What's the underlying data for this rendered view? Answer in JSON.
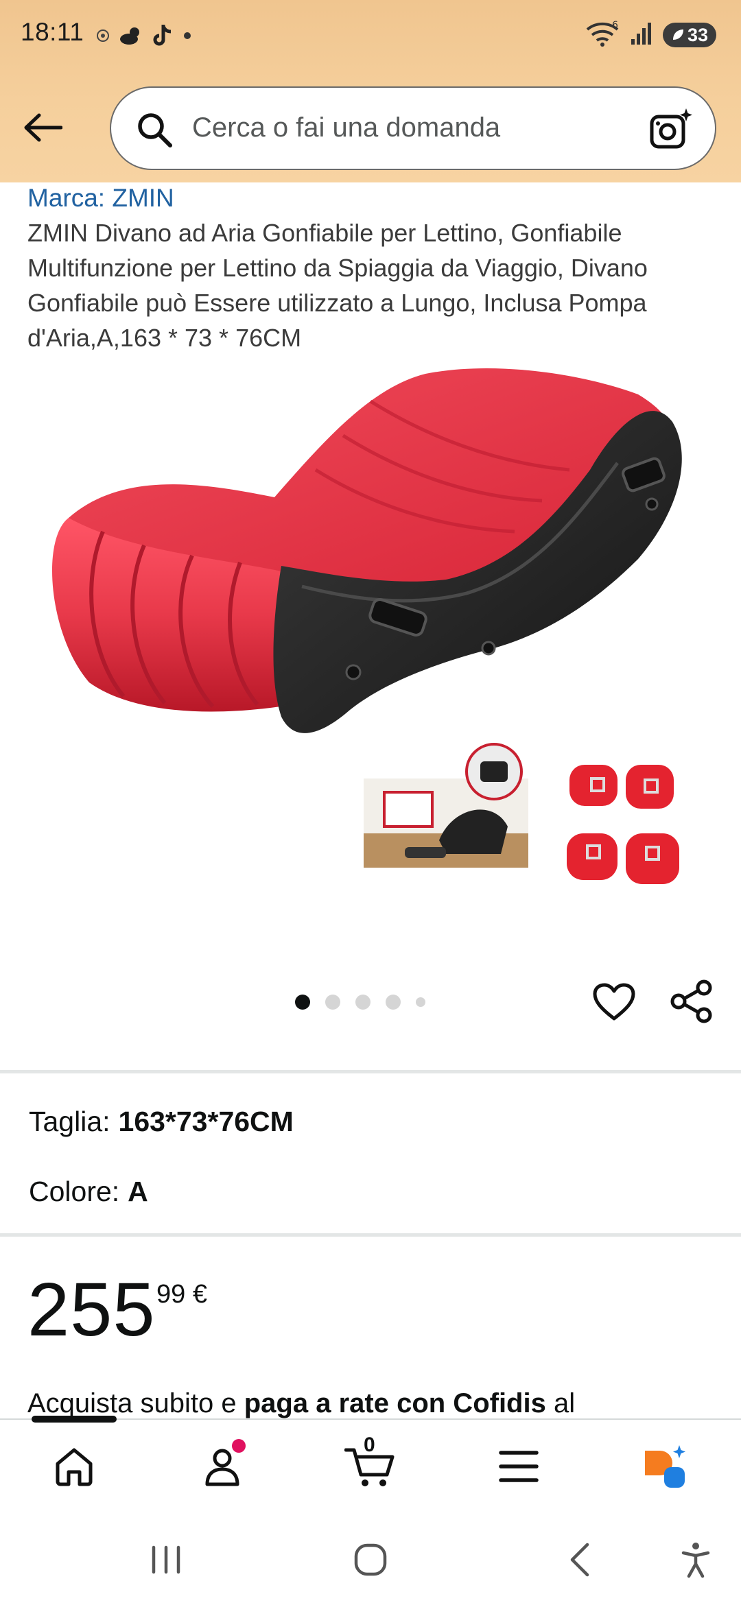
{
  "status_bar": {
    "time": "18:11",
    "wifi_badge": "6",
    "battery": "33",
    "icons": [
      "vpn-icon",
      "weather-icon",
      "tiktok-icon",
      "dot-icon",
      "wifi-icon",
      "signal-icon",
      "battery-saver-icon"
    ]
  },
  "header": {
    "back_icon": "arrow-left-icon",
    "search_placeholder": "Cerca o fai una domanda",
    "camera_icon": "camera-sparkle-icon"
  },
  "product": {
    "brand": "Marca: ZMIN",
    "title": "ZMIN Divano ad Aria Gonfiabile per Lettino, Gonfiabile Multifunzione per Lettino da Spiaggia da Viaggio, Divano Gonfiabile può Essere utilizzato a Lungo, Inclusa Pompa d'Aria,A,163 * 73 * 76CM",
    "image_count": 5,
    "active_image_index": 1
  },
  "variations": {
    "size_label": "Taglia:",
    "size_value": "163*73*76CM",
    "color_label": "Colore:",
    "color_value": "A"
  },
  "price": {
    "whole": "255",
    "fraction": "99",
    "currency": "€"
  },
  "installments": {
    "text_prefix": "Acquista subito e ",
    "text_bold": "paga a rate con Cofidis",
    "text_suffix": " al"
  },
  "bottom_nav": {
    "cart_count": "0",
    "items": [
      "home-icon",
      "account-icon",
      "cart-icon",
      "menu-icon",
      "rufus-icon"
    ]
  },
  "colors": {
    "header_bg": "#f3c994",
    "brand_link": "#2162a1",
    "sofa_red": "#e8394a",
    "sofa_black": "#2a2a2a",
    "notification": "#e0115f"
  }
}
